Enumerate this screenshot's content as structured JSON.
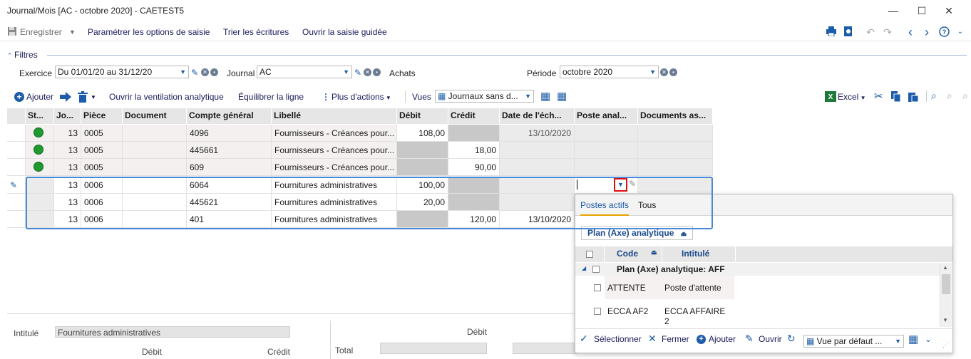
{
  "window": {
    "title": "Journal/Mois [AC - octobre 2020] - CAETEST5",
    "minimize": "—",
    "maximize": "☐",
    "close": "✕"
  },
  "toolbar": {
    "save_label": "Enregistrer",
    "items": [
      "Paramétrer les options de saisie",
      "Trier les écritures",
      "Ouvrir la saisie guidée"
    ]
  },
  "filters": {
    "header": "Filtres",
    "exercice_label": "Exercice",
    "exercice_value": "Du 01/01/20 au 31/12/20",
    "journal_label": "Journal",
    "journal_value": "AC",
    "journal_name": "Achats",
    "periode_label": "Période",
    "periode_value": "octobre 2020"
  },
  "gridbar": {
    "add": "Ajouter",
    "ventilation": "Ouvrir la ventilation analytique",
    "equilibrer": "Équilibrer la ligne",
    "more": "Plus d'actions",
    "vues": "Vues",
    "vue_value": "Journaux sans d...",
    "excel": "Excel"
  },
  "grid": {
    "headers": [
      "St...",
      "Jo...",
      "Pièce",
      "Document",
      "Compte général",
      "Libellé",
      "Débit",
      "Crédit",
      "Date de l'éch...",
      "Poste anal...",
      "Documents as..."
    ],
    "rows": [
      {
        "status": "green",
        "jour": "13",
        "piece": "0005",
        "document": "",
        "compte": "4096",
        "libelle": "Fournisseurs - Créances pour...",
        "debit": "108,00",
        "credit": "",
        "date": "13/10/2020",
        "poste": ""
      },
      {
        "status": "green",
        "jour": "13",
        "piece": "0005",
        "document": "",
        "compte": "445661",
        "libelle": "Fournisseurs - Créances pour...",
        "debit": "",
        "credit": "18,00",
        "date": "",
        "poste": ""
      },
      {
        "status": "green",
        "jour": "13",
        "piece": "0005",
        "document": "",
        "compte": "609",
        "libelle": "Fournisseurs - Créances pour...",
        "debit": "",
        "credit": "90,00",
        "date": "",
        "poste": ""
      },
      {
        "status": "",
        "jour": "13",
        "piece": "0006",
        "document": "",
        "compte": "6064",
        "libelle": "Fournitures administratives",
        "debit": "100,00",
        "credit": "",
        "date": "",
        "poste": ""
      },
      {
        "status": "",
        "jour": "13",
        "piece": "0006",
        "document": "",
        "compte": "445621",
        "libelle": "Fournitures administratives",
        "debit": "20,00",
        "credit": "",
        "date": "",
        "poste": ""
      },
      {
        "status": "",
        "jour": "13",
        "piece": "0006",
        "document": "",
        "compte": "401",
        "libelle": "Fournitures administratives",
        "debit": "",
        "credit": "120,00",
        "date": "13/10/2020",
        "poste": ""
      }
    ]
  },
  "dropdown": {
    "tabs": [
      "Postes actifs",
      "Tous"
    ],
    "plan_button": "Plan (Axe) analytique",
    "col_code": "Code",
    "col_intitule": "Intitulé",
    "group": "Plan (Axe) analytique: AFF",
    "items": [
      {
        "code": "ATTENTE",
        "intitule": "Poste d'attente"
      },
      {
        "code": "ECCA AF2",
        "intitule": "ECCA AFFAIRE 2"
      }
    ],
    "footer": {
      "select": "Sélectionner",
      "close": "Fermer",
      "add": "Ajouter",
      "open": "Ouvrir",
      "view": "Vue par défaut ..."
    }
  },
  "footer": {
    "intitule_label": "Intitulé",
    "intitule_value": "Fournitures administratives",
    "debit_label": "Débit",
    "credit_label": "Crédit",
    "debit_label2": "Débit",
    "total_label": "Total"
  },
  "colors": {
    "accent": "#1c5ca8",
    "status_ok": "#1e9a2e",
    "highlight_border": "#e01010"
  }
}
